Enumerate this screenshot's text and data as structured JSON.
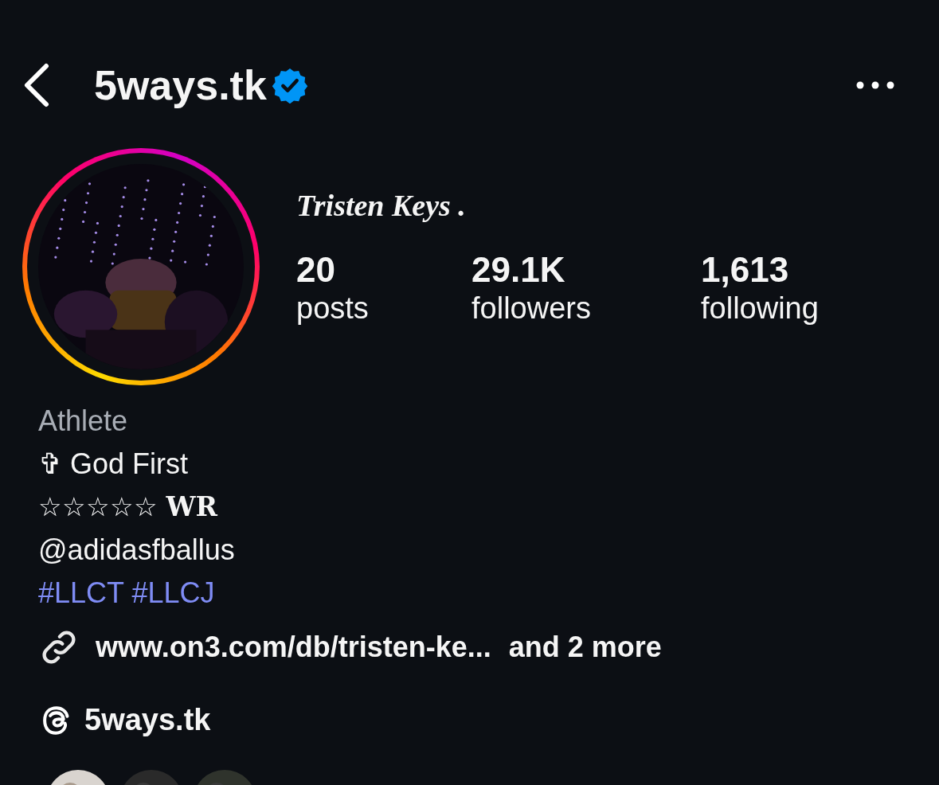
{
  "header": {
    "username": "5ways.tk",
    "verified": true
  },
  "profile": {
    "display_name": "Tristen Keys .",
    "has_story": true,
    "stats": [
      {
        "value": "20",
        "label": "posts"
      },
      {
        "value": "29.1K",
        "label": "followers"
      },
      {
        "value": "1,613",
        "label": "following"
      }
    ]
  },
  "bio": {
    "category": "Athlete",
    "lines": [
      {
        "kind": "plain",
        "text": "✞ God First"
      },
      {
        "kind": "serif",
        "text": "☆☆☆☆☆ **WR**"
      },
      {
        "kind": "plain",
        "text": "@adidasfballus"
      },
      {
        "kind": "hashtags",
        "text": "#LLCT #LLCJ"
      }
    ]
  },
  "link": {
    "url": "www.on3.com/db/tristen-ke...",
    "more": "and 2 more"
  },
  "threads": {
    "handle": "5ways.tk"
  }
}
